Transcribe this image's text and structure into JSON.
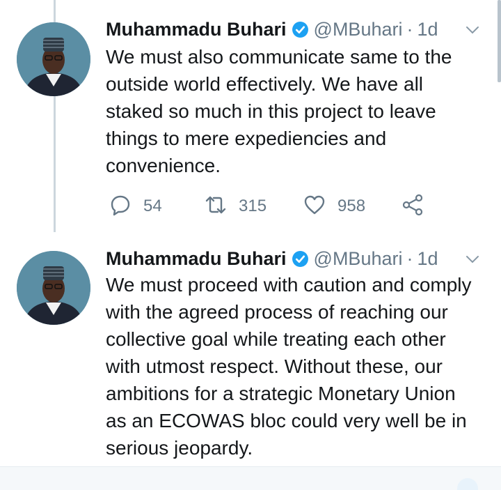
{
  "tweets": [
    {
      "author_name": "Muhammadu Buhari",
      "handle": "@MBuhari",
      "separator": "·",
      "time": "1d",
      "text": "We must also communicate same to the\noutside world effectively. We have all\nstaked so much in this project to leave\nthings to mere expediencies and\nconvenience.",
      "replies": "54",
      "retweets": "315",
      "likes": "958"
    },
    {
      "author_name": "Muhammadu Buhari",
      "handle": "@MBuhari",
      "separator": "·",
      "time": "1d",
      "text": "We must proceed with caution and comply\nwith the agreed process of reaching our\ncollective goal while treating each other\nwith utmost respect. Without these, our\nambitions for a strategic Monetary Union\nas an ECOWAS bloc could very well be in\nserious jeopardy."
    }
  ],
  "icons": {
    "verified": "verified-badge-icon",
    "caret": "chevron-down-icon",
    "reply": "reply-icon",
    "retweet": "retweet-icon",
    "like": "heart-icon",
    "share": "share-icon"
  },
  "colors": {
    "text": "#14171a",
    "muted": "#657786",
    "verified": "#1da1f2",
    "thread_line": "#ccd6dd"
  }
}
